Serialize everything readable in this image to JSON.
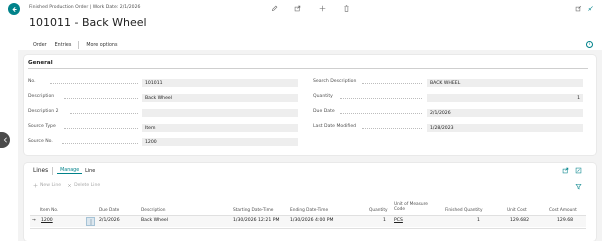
{
  "header": {
    "breadcrumb": "Finished Production Order | Work Date: 2/1/2026",
    "title": "101011 - Back Wheel"
  },
  "actions": {
    "order": "Order",
    "entries": "Entries",
    "more": "More options"
  },
  "general": {
    "title": "General",
    "left": [
      {
        "label": "No.",
        "value": "101011"
      },
      {
        "label": "Description",
        "value": "Back Wheel"
      },
      {
        "label": "Description 2",
        "value": ""
      },
      {
        "label": "Source Type",
        "value": "Item"
      },
      {
        "label": "Source No.",
        "value": "1200"
      }
    ],
    "right": [
      {
        "label": "Search Description",
        "value": "BACK WHEEL"
      },
      {
        "label": "Quantity",
        "value": "1"
      },
      {
        "label": "Due Date",
        "value": "2/1/2026"
      },
      {
        "label": "Last Date Modified",
        "value": "1/28/2023"
      }
    ]
  },
  "lines": {
    "title": "Lines",
    "tabs": [
      "Manage",
      "Line"
    ],
    "new_line": "New Line",
    "delete_line": "Delete Line",
    "columns": {
      "item_no": "Item No.",
      "due_date": "Due Date",
      "description": "Description",
      "starting": "Starting Date-Time",
      "ending": "Ending Date-Time",
      "quantity": "Quantity",
      "uom": "Unit of Measure Code",
      "finished_qty": "Finished Quantity",
      "unit_cost": "Unit Cost",
      "cost_amount": "Cost Amount"
    },
    "row": {
      "item_no": "1200",
      "due_date": "2/1/2026",
      "description": "Back Wheel",
      "starting": "1/30/2026 12:21 PM",
      "ending": "1/30/2026 4:00 PM",
      "quantity": "1",
      "uom": "PCS",
      "finished_qty": "1",
      "unit_cost": "129.682",
      "cost_amount": "129.68"
    }
  },
  "icons": {
    "back": "arrow-left-icon",
    "edit": "pencil-icon",
    "share": "share-icon",
    "add": "plus-icon",
    "delete": "trash-icon",
    "expand": "expand-icon",
    "collapse": "collapse-icon",
    "info": "info-icon"
  },
  "colors": {
    "accent": "#00828a"
  }
}
